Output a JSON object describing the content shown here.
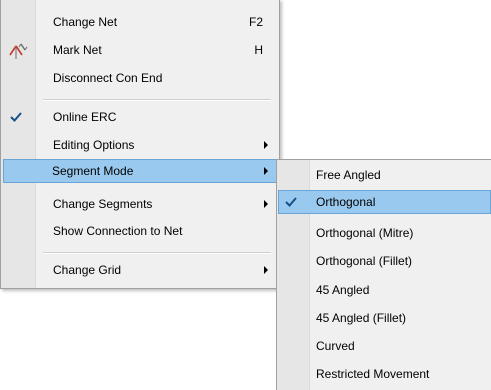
{
  "main_menu": {
    "items": [
      {
        "label": "Change Net",
        "shortcut": "F2"
      },
      {
        "label": "Mark Net",
        "shortcut": "H",
        "icon": "mark-net-icon"
      },
      {
        "label": "Disconnect Con End"
      },
      {
        "label": "Online ERC",
        "checked": true
      },
      {
        "label": "Editing Options",
        "submenu": true
      },
      {
        "label": "Segment Mode",
        "submenu": true,
        "highlighted": true
      },
      {
        "label": "Change Segments",
        "submenu": true
      },
      {
        "label": "Show Connection to Net"
      },
      {
        "label": "Change Grid",
        "submenu": true
      }
    ]
  },
  "segment_submenu": {
    "items": [
      {
        "label": "Free Angled"
      },
      {
        "label": "Orthogonal",
        "checked": true,
        "highlighted": true
      },
      {
        "label": "Orthogonal (Mitre)"
      },
      {
        "label": "Orthogonal (Fillet)"
      },
      {
        "label": "45 Angled"
      },
      {
        "label": "45 Angled (Fillet)"
      },
      {
        "label": "Curved"
      },
      {
        "label": "Restricted Movement"
      }
    ]
  },
  "colors": {
    "highlight": "#99c9ef",
    "highlight_border": "#6aa5d8",
    "menu_bg": "#f0f0f0",
    "gutter_bg": "#e6e6e6"
  }
}
